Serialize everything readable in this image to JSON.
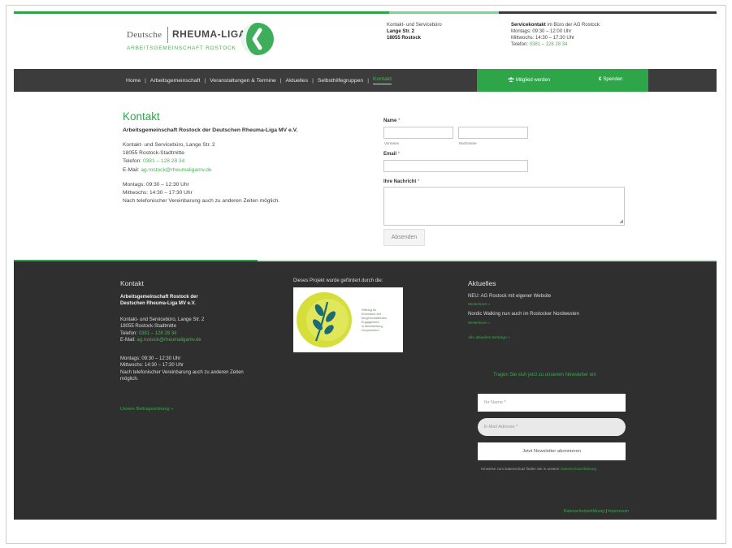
{
  "header": {
    "logo": {
      "word1": "Deutsche",
      "word2": "RHEUMA-LIGA",
      "subtitle": "ARBEITSGEMEINSCHAFT ROSTOCK",
      "mark_icon": "rheuma-liga-logo-mark"
    },
    "office": {
      "label": "Kontakt- und Servicebüro",
      "street": "Lange Str. 2",
      "city": "18055 Rostock"
    },
    "service": {
      "bold": "Servicekontakt",
      "rest": " im Büro der AG Rostock:",
      "line1": "Montags: 09:30 – 12:00 Uhr",
      "line2": "Mittwochs: 14:30 – 17:30 Uhr",
      "phone_label": "Telefon: ",
      "phone": "0381 – 128 28 34"
    }
  },
  "nav": {
    "items": [
      {
        "label": "Home"
      },
      {
        "label": "Arbeitsgemeinschaft"
      },
      {
        "label": "Veranstaltungen & Termine"
      },
      {
        "label": "Aktuelles"
      },
      {
        "label": "Selbsthilfegruppen"
      },
      {
        "label": "Kontakt"
      }
    ],
    "member": {
      "label": "Mitglied werden",
      "icon": "users-icon"
    },
    "donate": {
      "label": "Spenden",
      "icon": "euro-icon"
    }
  },
  "contact": {
    "title": "Kontakt",
    "org": "Arbeitsgemeinschaft Rostock der Deutschen Rheuma-Liga MV e.V.",
    "address": "Kontakt- und Servicebüro, Lange Str. 2",
    "city": "18055 Rostock-Stadtmitte",
    "phone_label": "Telefon: ",
    "phone": "0381 – 128 28 34",
    "email_label": "E-Mail: ",
    "email": "ag.rostock@rheumaligamv.de",
    "hours1": "Montags: 09:30 – 12:30 Uhr",
    "hours2": "Mittwochs: 14:30 – 17:30 Uhr",
    "hours3": "Nach telefonischer Vereinbarung auch zu anderen Zeiten möglich."
  },
  "form": {
    "name_label": "Name",
    "required_mark": "*",
    "first_sub": "Vorname",
    "last_sub": "Nachname",
    "email_label": "Email",
    "message_label": "Ihre Nachricht",
    "submit": "Absenden"
  },
  "footer": {
    "contact": {
      "heading": "Kontakt",
      "org1": "Arbeitsgemeinschaft Rostock der",
      "org2": "Deutschen Rheuma-Liga MV e.V.",
      "address": "Kontakt- und Servicebüro, Lange Str. 2",
      "city": "18055 Rostock-Stadtmitte",
      "phone_label": "Telefon: ",
      "phone": "0381 – 128 28 34",
      "email_label": "E-Mail: ",
      "email": "ag.rostock@rheumaligamv.de",
      "hours1": "Montags: 09:30 – 12:30 Uhr",
      "hours2": "Mittwochs: 14:30 – 17:30 Uhr",
      "hours3a": "Nach telefonischer Vereinbarung auch zu anderen Zeiten",
      "hours3b": "möglich.",
      "fee_link": "Unsere Beitragsordnung »"
    },
    "sponsor": {
      "caption": "Dieses Projekt wurde gefördert durch die:",
      "text1": "Stiftung für",
      "text2": "Ehrenamt und",
      "text3": "bürgerschaftliches",
      "text4": "Engagement",
      "text5": "in Mecklenburg-",
      "text6": "Vorpommern"
    },
    "news": {
      "heading": "Aktuelles",
      "item1": "NEU: AG Rostock mit eigener Website",
      "more1": "Weiterlesen »",
      "item2": "Nordic Walking nun auch im Rostocker Nordwesten",
      "more2": "Weiterlesen »",
      "all": "Alle aktuellen Beiträge »"
    },
    "newsletter": {
      "title": "Tragen Sie sich jetzt zu unserem Newsletter ein",
      "name_placeholder": "Ihr Name *",
      "email_placeholder": "E-Mail Adresse *",
      "button": "Jetzt Newsletter abonnieren",
      "note": "Hinweise zum Datenschutz finden Sie in unserer ",
      "note_link": "Datenschutzerklärung"
    },
    "legal": {
      "privacy": "Datenschutzerklärung",
      "sep": " | ",
      "imprint": "Impressum"
    }
  },
  "colors": {
    "brand_green": "#2fa54a",
    "dark": "#2f2f2f",
    "nav": "#3c3c3c"
  }
}
